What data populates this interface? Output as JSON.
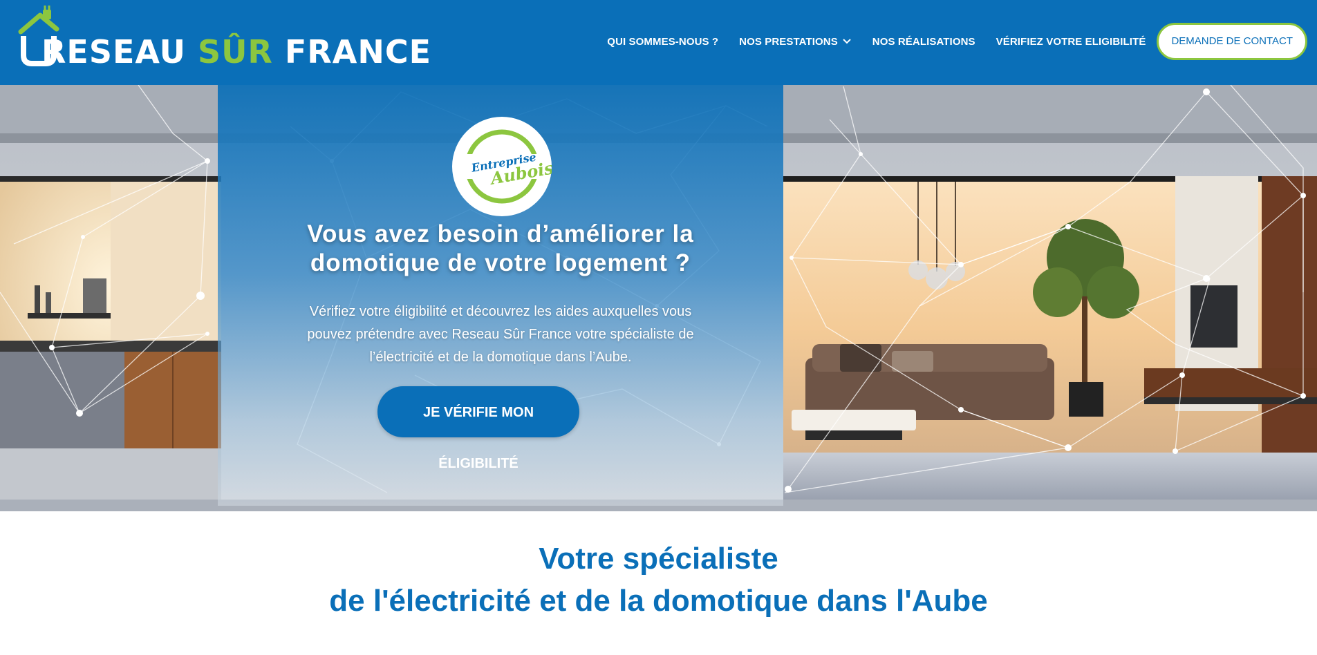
{
  "header": {
    "logo": {
      "part1": "RESEAU",
      "part2": "SÛR",
      "part3": "FRANCE"
    },
    "nav": [
      {
        "label": "QUI SOMMES-NOUS ?"
      },
      {
        "label": "NOS PRESTATIONS"
      },
      {
        "label": "NOS RÉALISATIONS"
      },
      {
        "label": "VÉRIFIEZ VOTRE ELIGIBILITÉ"
      }
    ],
    "contact_label": "DEMANDE DE CONTACT"
  },
  "hero": {
    "badge": {
      "line1": "Entreprise",
      "line2": "Auboise"
    },
    "title_line1": "Vous avez besoin d’améliorer la",
    "title_line2": "domotique de votre logement ?",
    "text_line1": "Vérifiez votre éligibilité et découvrez les aides auxquelles vous",
    "text_line2": "pouvez prétendre avec Reseau Sûr France votre spécialiste de",
    "text_line3": "l’électricité et de la domotique dans l’Aube.",
    "cta_label": "JE VÉRIFIE MON ÉLIGIBILITÉ"
  },
  "section": {
    "title_line1": "Votre spécialiste",
    "title_line2": "de l'électricité et de la domotique dans l'Aube"
  },
  "colors": {
    "brand_blue": "#0a6fb8",
    "brand_green": "#8cc63f",
    "white": "#ffffff"
  },
  "icons": [
    "house-plug-logo-icon",
    "chevron-down-icon",
    "entreprise-auboise-badge"
  ]
}
